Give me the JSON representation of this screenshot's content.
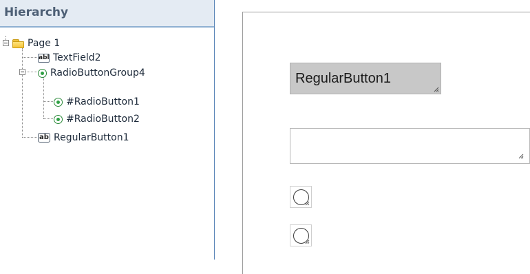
{
  "hierarchy": {
    "title": "Hierarchy",
    "items": [
      {
        "label": "Page 1",
        "icon": "folder-icon"
      },
      {
        "label": "TextField2",
        "icon": "textfield-icon",
        "icon_text": "abl"
      },
      {
        "label": "RadioButtonGroup4",
        "icon": "radio-icon"
      },
      {
        "label": "#RadioButton1",
        "icon": "radio-icon"
      },
      {
        "label": "#RadioButton2",
        "icon": "radio-icon"
      },
      {
        "label": "RegularButton1",
        "icon": "button-icon",
        "icon_text": "ab"
      }
    ]
  },
  "canvas": {
    "button_label": "RegularButton1",
    "text_field_value": "",
    "radio_buttons": [
      "#RadioButton1",
      "#RadioButton2"
    ]
  },
  "colors": {
    "panel_header_bg": "#e4ebf3",
    "panel_border": "#5b86b8",
    "button_bg": "#c8c8c8",
    "radio_green": "#2ea043"
  }
}
